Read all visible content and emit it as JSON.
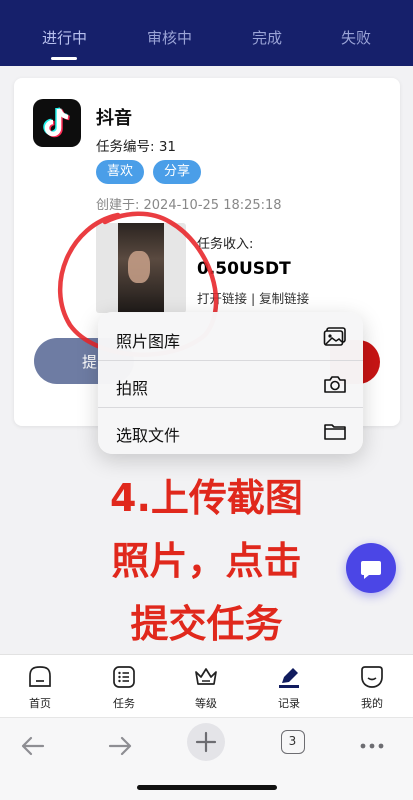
{
  "tabs": [
    {
      "label": "进行中",
      "active": true
    },
    {
      "label": "审核中",
      "active": false
    },
    {
      "label": "完成",
      "active": false
    },
    {
      "label": "失败",
      "active": false
    }
  ],
  "task": {
    "app_name": "抖音",
    "task_number": "任务编号: 31",
    "tags": [
      "喜欢",
      "分享"
    ],
    "created": "创建于: 2024-10-25 18:25:18",
    "income_label": "任务收入:",
    "income_value": "0.50USDT",
    "links": "打开链接 | 复制链接",
    "submit_partial": "提"
  },
  "action_sheet": {
    "items": [
      {
        "label": "照片图库",
        "icon": "photo-library-icon"
      },
      {
        "label": "拍照",
        "icon": "camera-icon"
      },
      {
        "label": "选取文件",
        "icon": "folder-icon"
      }
    ]
  },
  "annotation": {
    "lines": [
      "4.上传截图",
      "照片，点击",
      "提交任务"
    ],
    "color": "#e0281c"
  },
  "bottom_nav": [
    {
      "label": "首页",
      "icon": "home-icon"
    },
    {
      "label": "任务",
      "icon": "task-list-icon"
    },
    {
      "label": "等级",
      "icon": "crown-icon"
    },
    {
      "label": "记录",
      "icon": "record-edit-icon",
      "active": true
    },
    {
      "label": "我的",
      "icon": "profile-icon"
    }
  ],
  "browser": {
    "tab_count": "3"
  },
  "colors": {
    "header": "#16206b",
    "pill": "#4a9ee8",
    "fab": "#4b46e6"
  }
}
